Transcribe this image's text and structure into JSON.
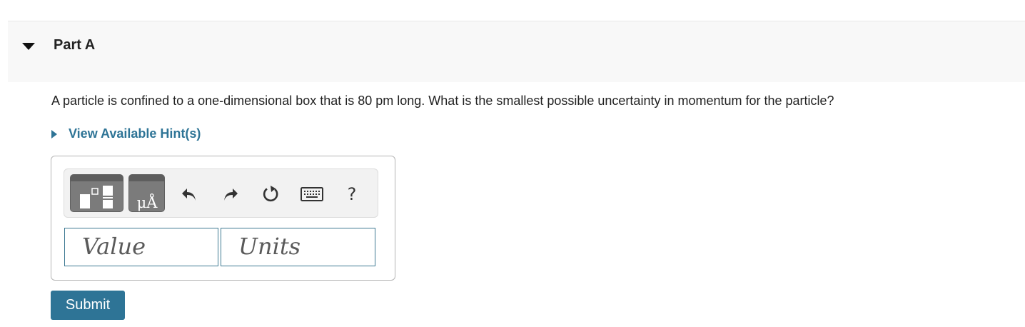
{
  "part": {
    "title": "Part A",
    "question": "A particle is confined to a one-dimensional box that is 80 pm long. What is the smallest possible uncertainty in momentum for the particle?"
  },
  "hint": {
    "label": "View Available Hint(s)"
  },
  "toolbar": {
    "units_button_text": "μÅ",
    "help_label": "?",
    "icons": [
      "templates-icon",
      "units-icon",
      "undo-icon",
      "redo-icon",
      "reset-icon",
      "keyboard-icon",
      "help-icon"
    ]
  },
  "answer": {
    "value_placeholder": "Value",
    "units_placeholder": "Units"
  },
  "submit": {
    "label": "Submit"
  },
  "colors": {
    "accent": "#2e7496",
    "header_bg": "#f8f8f8",
    "toolbar_btn": "#7b7b7b",
    "field_border": "#3f7a93"
  }
}
